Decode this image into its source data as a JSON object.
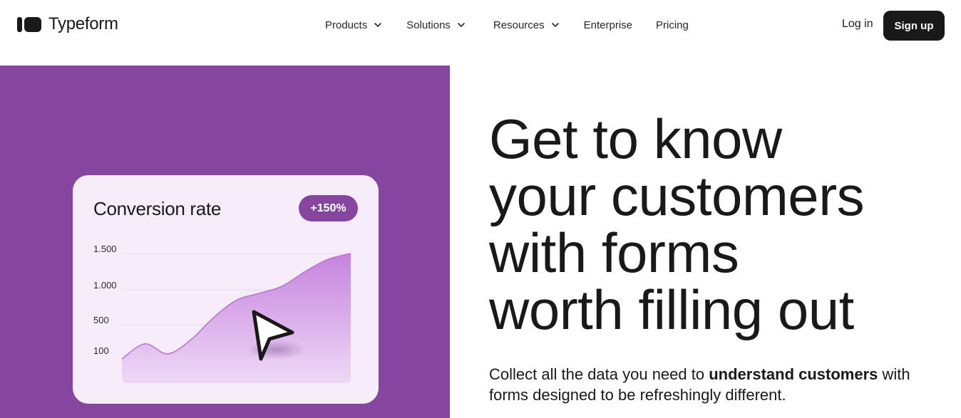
{
  "header": {
    "logo_text": "Typeform",
    "nav": [
      {
        "label": "Products",
        "has_dropdown": true
      },
      {
        "label": "Solutions",
        "has_dropdown": true
      },
      {
        "label": "Resources",
        "has_dropdown": true
      },
      {
        "label": "Enterprise",
        "has_dropdown": false
      },
      {
        "label": "Pricing",
        "has_dropdown": false
      }
    ],
    "login_label": "Log in",
    "signup_label": "Sign up"
  },
  "hero": {
    "headline_lines": [
      "Get to know",
      "your customers",
      "with forms",
      "worth filling out"
    ],
    "sub_prefix": "Collect all the data you need to ",
    "sub_bold": "understand customers",
    "sub_suffix": " with forms designed to be refreshingly different.",
    "card": {
      "title": "Conversion rate",
      "badge": "+150%",
      "cursor_icon": "play-cursor-icon"
    }
  },
  "colors": {
    "brand_purple": "#86469f",
    "card_bg": "#f7edfa",
    "chart_fill": "#c98ae0",
    "text_dark": "#191919"
  },
  "chart_data": {
    "type": "area",
    "y_ticks": [
      "1.500",
      "1.000",
      "500",
      "100"
    ],
    "x": [
      0,
      1,
      2,
      3,
      4,
      5,
      6,
      7,
      8,
      9,
      10
    ],
    "values": [
      60,
      250,
      120,
      300,
      600,
      850,
      950,
      1050,
      1250,
      1420,
      1500
    ],
    "ylim": [
      0,
      1500
    ]
  }
}
